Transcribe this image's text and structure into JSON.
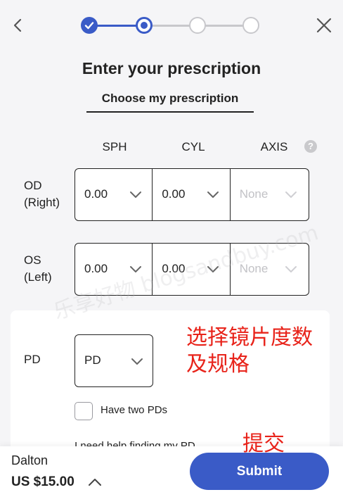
{
  "header": {
    "back_icon": "chevron-left-icon",
    "close_icon": "close-icon",
    "steps": [
      {
        "state": "done"
      },
      {
        "state": "current"
      },
      {
        "state": "todo"
      },
      {
        "state": "todo"
      }
    ],
    "accent_color": "#3a5bc7"
  },
  "title": "Enter your prescription",
  "subtab": "Choose my prescription",
  "columns": {
    "sph": "SPH",
    "cyl": "CYL",
    "axis": "AXIS",
    "help_icon": "question-icon"
  },
  "od": {
    "label_line1": "OD",
    "label_line2": "(Right)",
    "sph": "0.00",
    "cyl": "0.00",
    "axis": "None"
  },
  "os": {
    "label_line1": "OS",
    "label_line2": "(Left)",
    "sph": "0.00",
    "cyl": "0.00",
    "axis": "None"
  },
  "pd": {
    "label": "PD",
    "value": "PD",
    "two_pds_label": "Have two PDs",
    "two_pds_checked": false,
    "help_text": "I need help finding my PD"
  },
  "annotations": {
    "rx_note_line1": "选择镜片度数",
    "rx_note_line2": "及规格",
    "submit_note": "提交",
    "watermark": "乐享好物 blogsandbuy.com"
  },
  "footer": {
    "product_name": "Dalton",
    "price": "US $15.00",
    "submit_label": "Submit"
  }
}
